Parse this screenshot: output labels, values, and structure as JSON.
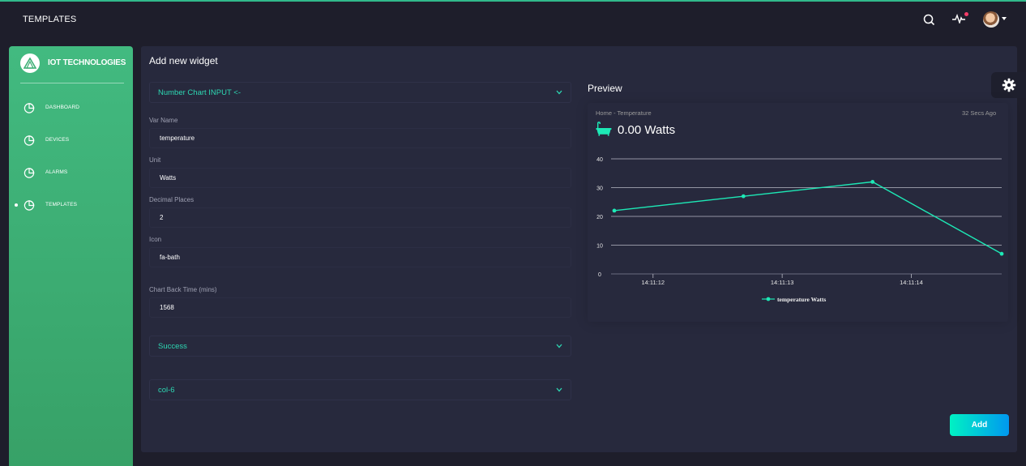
{
  "topbar": {
    "title": "TEMPLATES",
    "search_icon": "search-icon",
    "activity_icon": "activity-icon",
    "accent": "#31b98b"
  },
  "sidebar": {
    "brand": "IOT TECHNOLOGIES",
    "items": [
      {
        "label": "DASHBOARD",
        "icon": "chart-pie-icon"
      },
      {
        "label": "DEVICES",
        "icon": "chart-pie-icon"
      },
      {
        "label": "ALARMS",
        "icon": "chart-pie-icon"
      },
      {
        "label": "TEMPLATES",
        "icon": "chart-pie-icon",
        "active": true
      }
    ],
    "gradient": [
      "#42ba80",
      "#37a167"
    ]
  },
  "form": {
    "title": "Add new widget",
    "widget_type": "Number Chart INPUT <-",
    "var_name": {
      "label": "Var Name",
      "value": "temperature"
    },
    "unit": {
      "label": "Unit",
      "value": "Watts"
    },
    "decimal_places": {
      "label": "Decimal Places",
      "value": "2"
    },
    "icon": {
      "label": "Icon",
      "value": "fa-bath"
    },
    "chart_back_time": {
      "label": "Chart Back Time (mins)",
      "value": "1568"
    },
    "color_select": "Success",
    "column_select": "col-6",
    "add_label": "Add"
  },
  "preview": {
    "title": "Preview",
    "subtitle": "Home - Temperature",
    "time_ago": "32 Secs Ago",
    "value_text": "0.00 Watts",
    "icon": "bath-icon",
    "color": "#1de9b6"
  },
  "chart_data": {
    "type": "line",
    "series": [
      {
        "name": "temperature Watts",
        "x": [
          0,
          1,
          2,
          3
        ],
        "values": [
          22,
          27,
          32,
          7
        ]
      }
    ],
    "x_ticks": [
      {
        "label": "14:11:12",
        "at": 0.3
      },
      {
        "label": "14:11:13",
        "at": 1.3
      },
      {
        "label": "14:11:14",
        "at": 2.3
      }
    ],
    "ylim": [
      0,
      40
    ],
    "y_ticks": [
      0,
      10,
      20,
      30,
      40
    ],
    "grid": true,
    "legend": "bottom"
  }
}
